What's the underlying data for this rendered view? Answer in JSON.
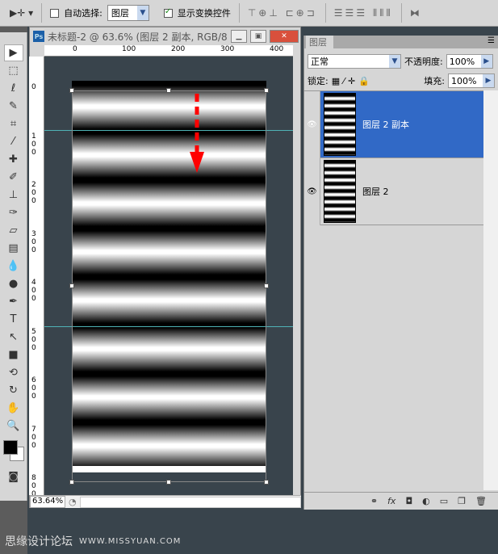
{
  "options_bar": {
    "auto_select_label": "自动选择:",
    "auto_select_checked": false,
    "auto_select_value": "图层",
    "show_transform_label": "显示变换控件",
    "show_transform_checked": true
  },
  "document": {
    "title": "未标题-2 @ 63.6% (图层 2 副本, RGB/8...",
    "zoom": "63.64%",
    "ruler_top": [
      "0",
      "100",
      "200",
      "300",
      "400"
    ],
    "ruler_left": [
      "0",
      "100",
      "200",
      "300",
      "400",
      "500",
      "600",
      "700",
      "800"
    ]
  },
  "layers_panel": {
    "tab": "图层",
    "blend_mode": "正常",
    "opacity_label": "不透明度:",
    "opacity": "100%",
    "lock_label": "锁定:",
    "fill_label": "填充:",
    "fill": "100%",
    "layers": [
      {
        "name": "图层 2 副本",
        "selected": true,
        "visible": true
      },
      {
        "name": "图层 2",
        "selected": false,
        "visible": true
      }
    ],
    "footer_icons": [
      "link-icon",
      "fx-icon",
      "mask-icon",
      "adjustment-icon",
      "group-icon",
      "new-layer-icon",
      "trash-icon"
    ]
  },
  "watermark": {
    "text": "思缘设计论坛",
    "url": "WWW.MISSYUAN.COM"
  },
  "colors": {
    "selection": "#3169c6",
    "guide": "#4fb3b6",
    "arrow": "#ff0000",
    "pasteboard": "#39444c"
  }
}
